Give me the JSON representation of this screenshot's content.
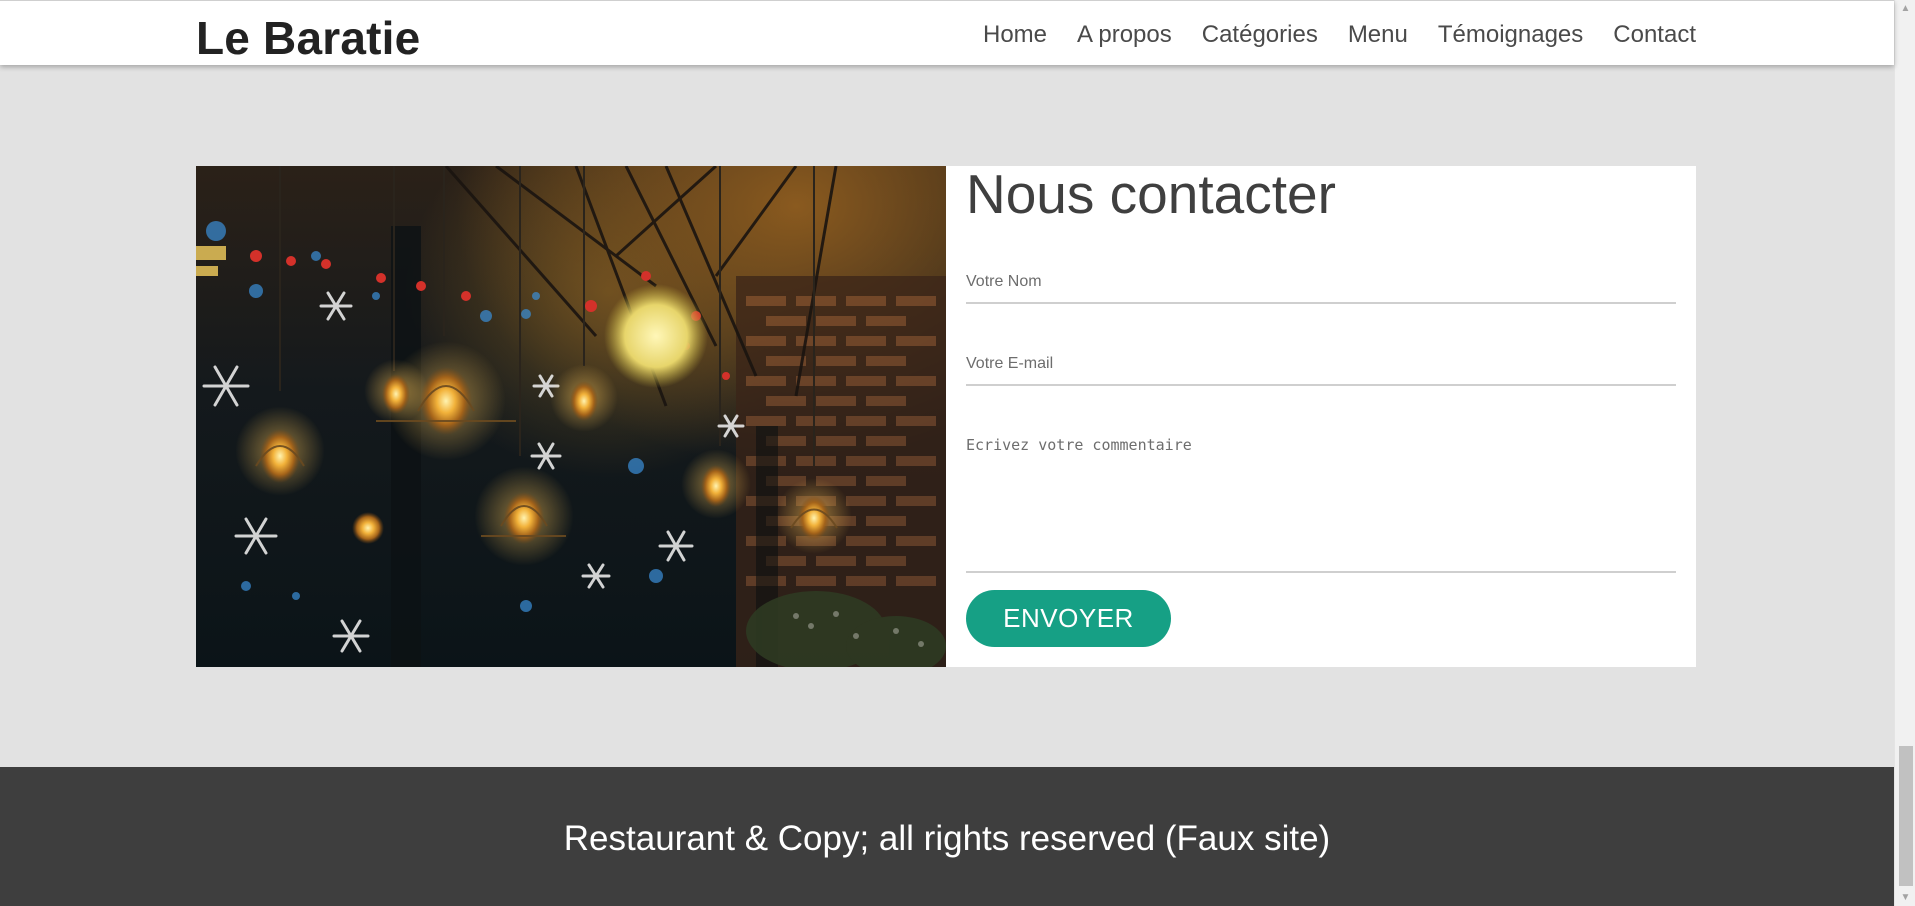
{
  "header": {
    "brand": "Le Baratie",
    "nav": [
      {
        "label": "Home"
      },
      {
        "label": "A propos"
      },
      {
        "label": "Catégories"
      },
      {
        "label": "Menu"
      },
      {
        "label": "Témoignages"
      },
      {
        "label": "Contact"
      }
    ]
  },
  "contact": {
    "title": "Nous contacter",
    "name_placeholder": "Votre Nom",
    "email_placeholder": "Votre E-mail",
    "comment_placeholder": "Ecrivez votre commentaire",
    "submit_label": "ENVOYER"
  },
  "footer": {
    "text": "Restaurant & Copy; all rights reserved (Faux site)"
  },
  "colors": {
    "accent": "#16a085",
    "footer_bg": "#3e3e3e",
    "page_bg": "#e2e2e2"
  },
  "icons": {
    "scroll_up": "triangle-up-icon",
    "scroll_down": "triangle-down-icon"
  }
}
